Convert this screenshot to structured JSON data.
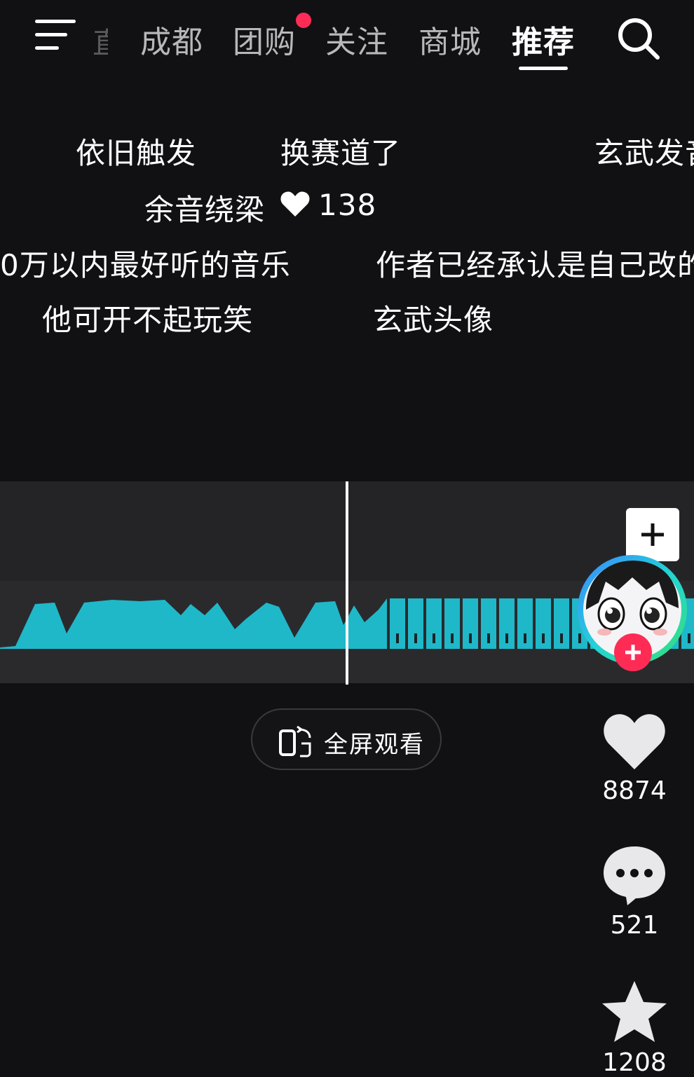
{
  "nav": {
    "partial_tab": "直",
    "tabs": [
      "成都",
      "团购",
      "关注",
      "商城",
      "推荐"
    ],
    "active_tab": "推荐",
    "has_notification_on": "团购"
  },
  "danmaku": {
    "line1_a": "依旧触发",
    "line1_b": "换赛道了",
    "line1_c": "玄武发音",
    "line2": "余音绕梁",
    "line2_likes": "138",
    "line3_a": "0万以内最好听的音乐",
    "line3_b": "作者已经承认是自己改的",
    "line4_a": "他可开不起玩笑",
    "line4_b": "玄武头像"
  },
  "player": {
    "fullscreen_label": "全屏观看"
  },
  "actions": {
    "likes": "8874",
    "comments": "521",
    "favorites": "1208"
  },
  "colors": {
    "background": "#111114",
    "accent_red": "#fe2c55",
    "waveform": "#1fb8c9"
  },
  "icons": [
    "menu-icon",
    "search-icon",
    "heart-icon",
    "comment-icon",
    "star-icon",
    "plus-icon",
    "rotate-screen-icon"
  ]
}
